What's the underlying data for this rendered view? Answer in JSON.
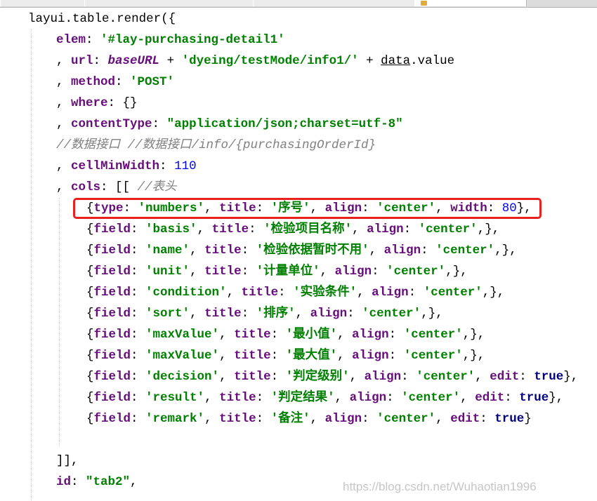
{
  "code_lines": [
    {
      "indent": 40,
      "tokens": [
        {
          "t": "layui",
          "c": "pl"
        },
        {
          "t": ".",
          "c": "pu"
        },
        {
          "t": "table",
          "c": "pl"
        },
        {
          "t": ".",
          "c": "pu"
        },
        {
          "t": "render",
          "c": "pl"
        },
        {
          "t": "({",
          "c": "pu"
        }
      ]
    },
    {
      "indent": 80,
      "tokens": [
        {
          "t": "elem",
          "c": "pr"
        },
        {
          "t": ": ",
          "c": "pu"
        },
        {
          "t": "'#lay-purchasing-detail1'",
          "c": "st"
        }
      ]
    },
    {
      "indent": 80,
      "tokens": [
        {
          "t": ", ",
          "c": "pu"
        },
        {
          "t": "url",
          "c": "pr"
        },
        {
          "t": ": ",
          "c": "pu"
        },
        {
          "t": "baseURL",
          "c": "gv"
        },
        {
          "t": " + ",
          "c": "pu"
        },
        {
          "t": "'dyeing/testMode/info1/'",
          "c": "st"
        },
        {
          "t": " + ",
          "c": "pu"
        },
        {
          "t": "data",
          "c": "pl ul"
        },
        {
          "t": ".",
          "c": "pu"
        },
        {
          "t": "value",
          "c": "pl"
        }
      ]
    },
    {
      "indent": 80,
      "tokens": [
        {
          "t": ", ",
          "c": "pu"
        },
        {
          "t": "method",
          "c": "pr"
        },
        {
          "t": ": ",
          "c": "pu"
        },
        {
          "t": "'POST'",
          "c": "st"
        }
      ]
    },
    {
      "indent": 80,
      "tokens": [
        {
          "t": ", ",
          "c": "pu"
        },
        {
          "t": "where",
          "c": "pr"
        },
        {
          "t": ": {}",
          "c": "pu"
        }
      ]
    },
    {
      "indent": 80,
      "tokens": [
        {
          "t": ", ",
          "c": "pu"
        },
        {
          "t": "contentType",
          "c": "pr"
        },
        {
          "t": ": ",
          "c": "pu"
        },
        {
          "t": "\"application/json;charset=utf-8\"",
          "c": "st"
        }
      ]
    },
    {
      "indent": 80,
      "tokens": [
        {
          "t": "//数据接口 //数据接口/info/{purchasingOrderId}",
          "c": "cm"
        }
      ]
    },
    {
      "indent": 80,
      "tokens": [
        {
          "t": ", ",
          "c": "pu"
        },
        {
          "t": "cellMinWidth",
          "c": "pr"
        },
        {
          "t": ": ",
          "c": "pu"
        },
        {
          "t": "110",
          "c": "nu"
        }
      ]
    },
    {
      "indent": 80,
      "tokens": [
        {
          "t": ", ",
          "c": "pu"
        },
        {
          "t": "cols",
          "c": "pr"
        },
        {
          "t": ": [[ ",
          "c": "pu"
        },
        {
          "t": "//表头",
          "c": "cm"
        }
      ]
    },
    {
      "indent": 123,
      "tokens": [
        {
          "t": "{",
          "c": "pu"
        },
        {
          "t": "type",
          "c": "pr"
        },
        {
          "t": ": ",
          "c": "pu"
        },
        {
          "t": "'numbers'",
          "c": "st"
        },
        {
          "t": ", ",
          "c": "pu"
        },
        {
          "t": "title",
          "c": "pr"
        },
        {
          "t": ": ",
          "c": "pu"
        },
        {
          "t": "'序号'",
          "c": "st"
        },
        {
          "t": ", ",
          "c": "pu"
        },
        {
          "t": "align",
          "c": "pr"
        },
        {
          "t": ": ",
          "c": "pu"
        },
        {
          "t": "'center'",
          "c": "st"
        },
        {
          "t": ", ",
          "c": "pu"
        },
        {
          "t": "width",
          "c": "pr"
        },
        {
          "t": ": ",
          "c": "pu"
        },
        {
          "t": "80",
          "c": "nu"
        },
        {
          "t": "},",
          "c": "pu"
        }
      ]
    },
    {
      "indent": 123,
      "tokens": [
        {
          "t": "{",
          "c": "pu"
        },
        {
          "t": "field",
          "c": "pr"
        },
        {
          "t": ": ",
          "c": "pu"
        },
        {
          "t": "'basis'",
          "c": "st"
        },
        {
          "t": ", ",
          "c": "pu"
        },
        {
          "t": "title",
          "c": "pr"
        },
        {
          "t": ": ",
          "c": "pu"
        },
        {
          "t": "'检验项目名称'",
          "c": "st"
        },
        {
          "t": ", ",
          "c": "pu"
        },
        {
          "t": "align",
          "c": "pr"
        },
        {
          "t": ": ",
          "c": "pu"
        },
        {
          "t": "'center'",
          "c": "st"
        },
        {
          "t": ",},",
          "c": "pu"
        }
      ]
    },
    {
      "indent": 123,
      "tokens": [
        {
          "t": "{",
          "c": "pu"
        },
        {
          "t": "field",
          "c": "pr"
        },
        {
          "t": ": ",
          "c": "pu"
        },
        {
          "t": "'name'",
          "c": "st"
        },
        {
          "t": ", ",
          "c": "pu"
        },
        {
          "t": "title",
          "c": "pr"
        },
        {
          "t": ": ",
          "c": "pu"
        },
        {
          "t": "'检验依据暂时不用'",
          "c": "st"
        },
        {
          "t": ", ",
          "c": "pu"
        },
        {
          "t": "align",
          "c": "pr"
        },
        {
          "t": ": ",
          "c": "pu"
        },
        {
          "t": "'center'",
          "c": "st"
        },
        {
          "t": ",},",
          "c": "pu"
        }
      ]
    },
    {
      "indent": 123,
      "tokens": [
        {
          "t": "{",
          "c": "pu"
        },
        {
          "t": "field",
          "c": "pr"
        },
        {
          "t": ": ",
          "c": "pu"
        },
        {
          "t": "'unit'",
          "c": "st"
        },
        {
          "t": ", ",
          "c": "pu"
        },
        {
          "t": "title",
          "c": "pr"
        },
        {
          "t": ": ",
          "c": "pu"
        },
        {
          "t": "'计量单位'",
          "c": "st"
        },
        {
          "t": ", ",
          "c": "pu"
        },
        {
          "t": "align",
          "c": "pr"
        },
        {
          "t": ": ",
          "c": "pu"
        },
        {
          "t": "'center'",
          "c": "st"
        },
        {
          "t": ",},",
          "c": "pu"
        }
      ]
    },
    {
      "indent": 123,
      "tokens": [
        {
          "t": "{",
          "c": "pu"
        },
        {
          "t": "field",
          "c": "pr"
        },
        {
          "t": ": ",
          "c": "pu"
        },
        {
          "t": "'condition'",
          "c": "st"
        },
        {
          "t": ", ",
          "c": "pu"
        },
        {
          "t": "title",
          "c": "pr"
        },
        {
          "t": ": ",
          "c": "pu"
        },
        {
          "t": "'实验条件'",
          "c": "st"
        },
        {
          "t": ", ",
          "c": "pu"
        },
        {
          "t": "align",
          "c": "pr"
        },
        {
          "t": ": ",
          "c": "pu"
        },
        {
          "t": "'center'",
          "c": "st"
        },
        {
          "t": ",},",
          "c": "pu"
        }
      ]
    },
    {
      "indent": 123,
      "tokens": [
        {
          "t": "{",
          "c": "pu"
        },
        {
          "t": "field",
          "c": "pr"
        },
        {
          "t": ": ",
          "c": "pu"
        },
        {
          "t": "'sort'",
          "c": "st"
        },
        {
          "t": ", ",
          "c": "pu"
        },
        {
          "t": "title",
          "c": "pr"
        },
        {
          "t": ": ",
          "c": "pu"
        },
        {
          "t": "'排序'",
          "c": "st"
        },
        {
          "t": ", ",
          "c": "pu"
        },
        {
          "t": "align",
          "c": "pr"
        },
        {
          "t": ": ",
          "c": "pu"
        },
        {
          "t": "'center'",
          "c": "st"
        },
        {
          "t": ",},",
          "c": "pu"
        }
      ]
    },
    {
      "indent": 123,
      "tokens": [
        {
          "t": "{",
          "c": "pu"
        },
        {
          "t": "field",
          "c": "pr"
        },
        {
          "t": ": ",
          "c": "pu"
        },
        {
          "t": "'maxValue'",
          "c": "st"
        },
        {
          "t": ", ",
          "c": "pu"
        },
        {
          "t": "title",
          "c": "pr"
        },
        {
          "t": ": ",
          "c": "pu"
        },
        {
          "t": "'最小值'",
          "c": "st"
        },
        {
          "t": ", ",
          "c": "pu"
        },
        {
          "t": "align",
          "c": "pr"
        },
        {
          "t": ": ",
          "c": "pu"
        },
        {
          "t": "'center'",
          "c": "st"
        },
        {
          "t": ",},",
          "c": "pu"
        }
      ]
    },
    {
      "indent": 123,
      "tokens": [
        {
          "t": "{",
          "c": "pu"
        },
        {
          "t": "field",
          "c": "pr"
        },
        {
          "t": ": ",
          "c": "pu"
        },
        {
          "t": "'maxValue'",
          "c": "st"
        },
        {
          "t": ", ",
          "c": "pu"
        },
        {
          "t": "title",
          "c": "pr"
        },
        {
          "t": ": ",
          "c": "pu"
        },
        {
          "t": "'最大值'",
          "c": "st"
        },
        {
          "t": ", ",
          "c": "pu"
        },
        {
          "t": "align",
          "c": "pr"
        },
        {
          "t": ": ",
          "c": "pu"
        },
        {
          "t": "'center'",
          "c": "st"
        },
        {
          "t": ",},",
          "c": "pu"
        }
      ]
    },
    {
      "indent": 123,
      "tokens": [
        {
          "t": "{",
          "c": "pu"
        },
        {
          "t": "field",
          "c": "pr"
        },
        {
          "t": ": ",
          "c": "pu"
        },
        {
          "t": "'decision'",
          "c": "st"
        },
        {
          "t": ", ",
          "c": "pu"
        },
        {
          "t": "title",
          "c": "pr"
        },
        {
          "t": ": ",
          "c": "pu"
        },
        {
          "t": "'判定级别'",
          "c": "st"
        },
        {
          "t": ", ",
          "c": "pu"
        },
        {
          "t": "align",
          "c": "pr"
        },
        {
          "t": ": ",
          "c": "pu"
        },
        {
          "t": "'center'",
          "c": "st"
        },
        {
          "t": ", ",
          "c": "pu"
        },
        {
          "t": "edit",
          "c": "pr"
        },
        {
          "t": ": ",
          "c": "pu"
        },
        {
          "t": "true",
          "c": "kw"
        },
        {
          "t": "},",
          "c": "pu"
        }
      ]
    },
    {
      "indent": 123,
      "tokens": [
        {
          "t": "{",
          "c": "pu"
        },
        {
          "t": "field",
          "c": "pr"
        },
        {
          "t": ": ",
          "c": "pu"
        },
        {
          "t": "'result'",
          "c": "st"
        },
        {
          "t": ", ",
          "c": "pu"
        },
        {
          "t": "title",
          "c": "pr"
        },
        {
          "t": ": ",
          "c": "pu"
        },
        {
          "t": "'判定结果'",
          "c": "st"
        },
        {
          "t": ", ",
          "c": "pu"
        },
        {
          "t": "align",
          "c": "pr"
        },
        {
          "t": ": ",
          "c": "pu"
        },
        {
          "t": "'center'",
          "c": "st"
        },
        {
          "t": ", ",
          "c": "pu"
        },
        {
          "t": "edit",
          "c": "pr"
        },
        {
          "t": ": ",
          "c": "pu"
        },
        {
          "t": "true",
          "c": "kw"
        },
        {
          "t": "},",
          "c": "pu"
        }
      ]
    },
    {
      "indent": 123,
      "tokens": [
        {
          "t": "{",
          "c": "pu"
        },
        {
          "t": "field",
          "c": "pr"
        },
        {
          "t": ": ",
          "c": "pu"
        },
        {
          "t": "'remark'",
          "c": "st"
        },
        {
          "t": ", ",
          "c": "pu"
        },
        {
          "t": "title",
          "c": "pr"
        },
        {
          "t": ": ",
          "c": "pu"
        },
        {
          "t": "'备注'",
          "c": "st"
        },
        {
          "t": ", ",
          "c": "pu"
        },
        {
          "t": "align",
          "c": "pr"
        },
        {
          "t": ": ",
          "c": "pu"
        },
        {
          "t": "'center'",
          "c": "st"
        },
        {
          "t": ", ",
          "c": "pu"
        },
        {
          "t": "edit",
          "c": "pr"
        },
        {
          "t": ": ",
          "c": "pu"
        },
        {
          "t": "true",
          "c": "kw"
        },
        {
          "t": "}",
          "c": "pu"
        }
      ]
    },
    {
      "indent": 80,
      "tokens": []
    },
    {
      "indent": 80,
      "tokens": [
        {
          "t": "]],",
          "c": "pu"
        }
      ]
    },
    {
      "indent": 80,
      "tokens": [
        {
          "t": "id",
          "c": "pr"
        },
        {
          "t": ": ",
          "c": "pu"
        },
        {
          "t": "\"tab2\"",
          "c": "st"
        },
        {
          "t": ",",
          "c": "pu"
        }
      ]
    }
  ],
  "watermark": "https://blog.csdn.net/Wuhaotian1996",
  "colors": {
    "property": "#660e7a",
    "string": "#008000",
    "keyword": "#000080",
    "number": "#0000ff",
    "comment": "#808080",
    "highlight_box": "#e8201e",
    "background": "#ffffff"
  }
}
